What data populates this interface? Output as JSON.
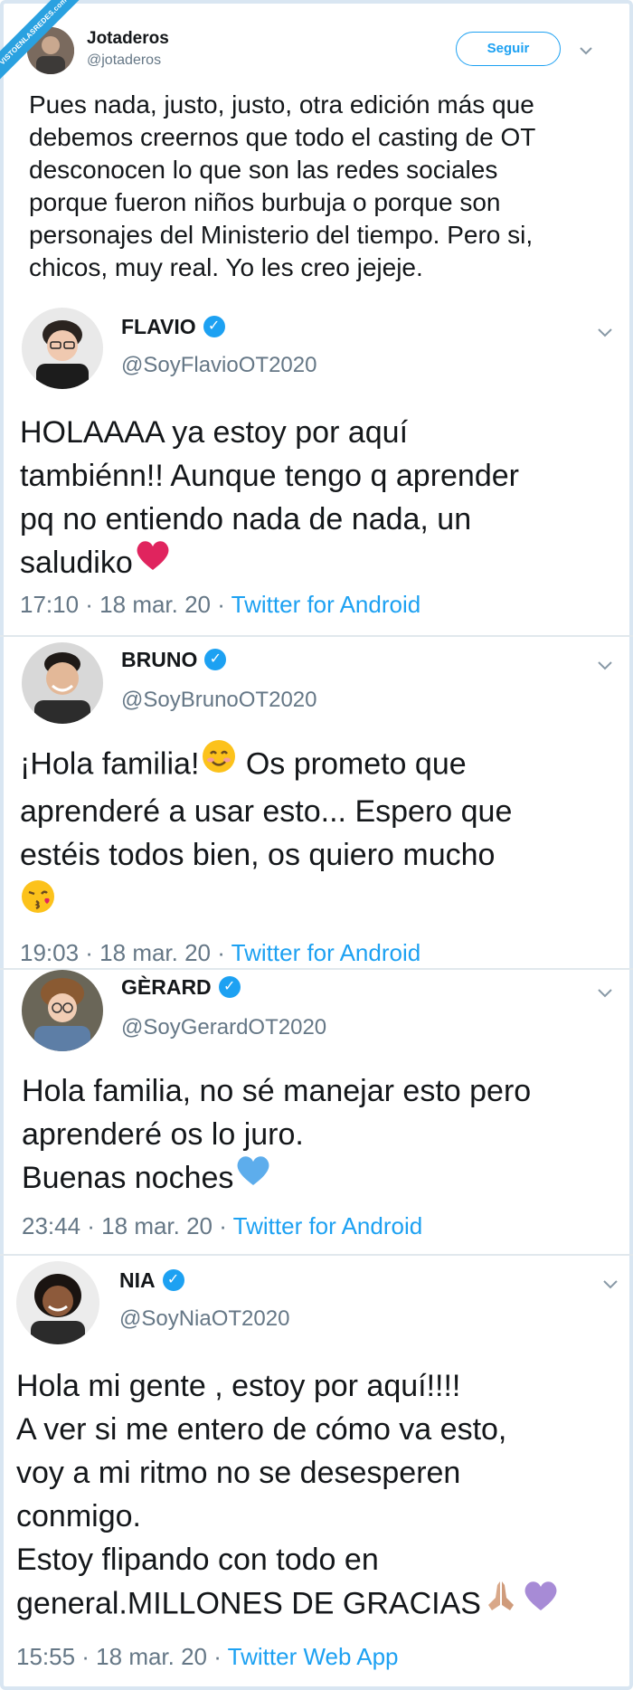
{
  "watermark": "VISTOENLASREDES.com",
  "top_tweet": {
    "name": "Jotaderos",
    "handle": "@jotaderos",
    "follow_label": "Seguir",
    "lines": [
      "Pues nada, justo, justo, otra edición más que",
      "debemos creernos que todo el casting de OT",
      "desconocen lo que son las redes sociales",
      "porque fueron niños burbuja o porque son",
      "personajes del Ministerio del tiempo. Pero si,",
      "chicos, muy real. Yo les creo jejeje."
    ]
  },
  "tweets": [
    {
      "name": "FLAVIO",
      "handle": "@SoyFlavioOT2020",
      "lines": [
        "HOLAAAA ya estoy por aquí",
        "tambiénn!! Aunque tengo q aprender",
        "pq no entiendo nada de nada, un",
        "saludiko"
      ],
      "time": "17:10 · 18 mar. 20 · ",
      "source": "Twitter for Android"
    },
    {
      "name": "BRUNO",
      "handle": "@SoyBrunoOT2020",
      "lines": [
        "¡Hola familia!",
        "aprenderé a usar esto... Espero que",
        "estéis todos bien, os quiero mucho"
      ],
      "line1_suffix": " Os prometo que",
      "time": "19:03 · 18 mar. 20 · ",
      "source": "Twitter for Android"
    },
    {
      "name": "GÈRARD",
      "handle": "@SoyGerardOT2020",
      "lines": [
        "Hola familia, no sé manejar esto pero",
        "aprenderé os lo juro.",
        "Buenas noches"
      ],
      "time": "23:44 · 18 mar. 20 · ",
      "source": "Twitter for Android"
    },
    {
      "name": "NIA",
      "handle": "@SoyNiaOT2020",
      "lines": [
        "Hola mi gente , estoy por aquí!!!!",
        "A ver si me entero de cómo va esto,",
        "voy a mi ritmo no se desesperen",
        "conmigo.",
        "Estoy flipando con todo en",
        "general.MILLONES DE GRACIAS"
      ],
      "time": "15:55 · 18 mar. 20 · ",
      "source": "Twitter Web App"
    }
  ],
  "colors": {
    "accent": "#1da1f2",
    "text": "#14171a",
    "muted": "#657786",
    "heart_red": "#e0245e",
    "heart_blue": "#5dadec",
    "heart_purple": "#a78bd6"
  },
  "icons": [
    "verified-badge-icon",
    "chevron-down-icon",
    "red-heart-emoji",
    "smiling-face-emoji",
    "kissing-face-emoji",
    "blue-heart-emoji",
    "folded-hands-emoji",
    "purple-heart-emoji"
  ]
}
